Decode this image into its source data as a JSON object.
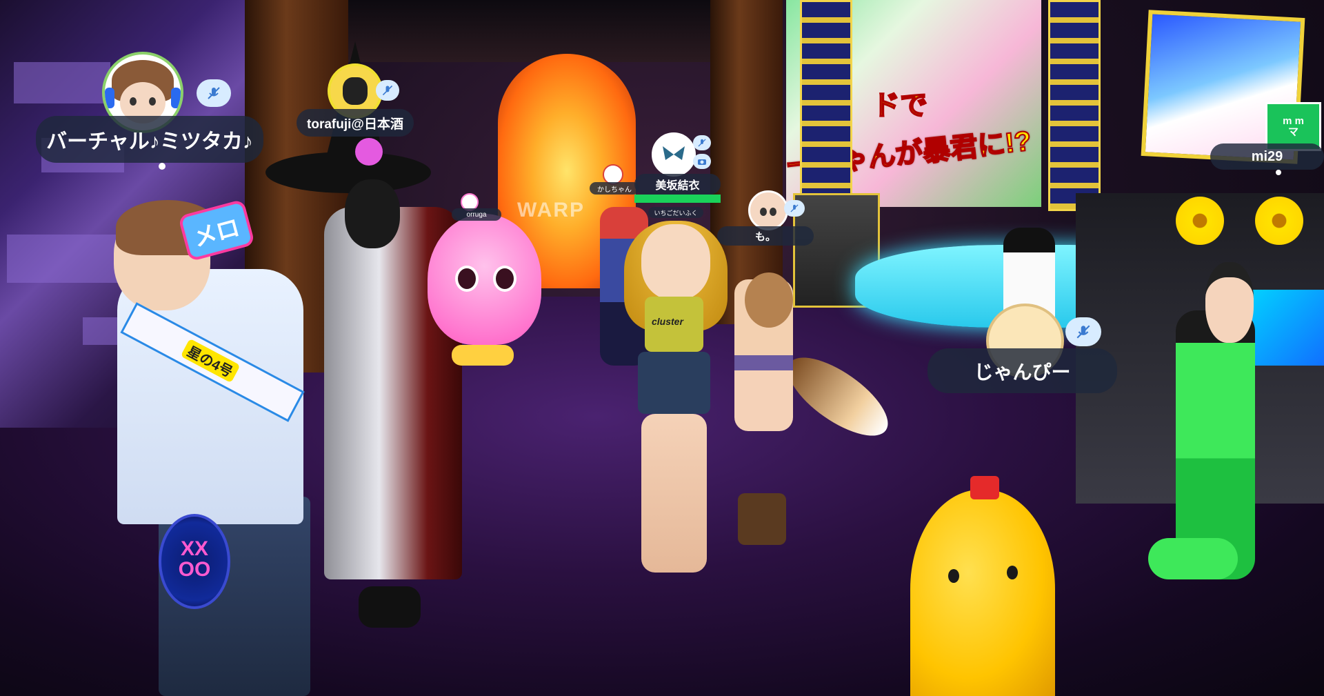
{
  "scene": {
    "arch_label": "WARP",
    "billboard_text_1": "ドで",
    "billboard_text_2": "ーちゃんが暴君に!?",
    "shirt_logo": "cluster",
    "sash_label": "星の4号",
    "badge_label": "メロ",
    "fan_label": "XX OO"
  },
  "nametags": [
    {
      "id": "virtual-mitsutaka",
      "name": "バーチャル♪ミツタカ♪",
      "mic": "muted"
    },
    {
      "id": "torafuji",
      "name": "torafuji@日本酒",
      "mic": "muted"
    },
    {
      "id": "kashichan",
      "name": "かしちゃん"
    },
    {
      "id": "oruga",
      "name": "orruga"
    },
    {
      "id": "misaka-yui",
      "name": "美坂結衣",
      "mic": "muted",
      "extra_icon": "camera"
    },
    {
      "id": "ichigo",
      "name": "いちごだいふく"
    },
    {
      "id": "mo",
      "name": "も。",
      "mic": "muted"
    },
    {
      "id": "janpi",
      "name": "じゃんぴー",
      "mic": "muted"
    },
    {
      "id": "mi29",
      "name": "mi29",
      "avatar_text": [
        "m m",
        "マ"
      ]
    }
  ],
  "colors": {
    "tag_bg": "#1e283c",
    "mic_bg": "#d8ecff",
    "accent_green": "#1ad25a"
  }
}
